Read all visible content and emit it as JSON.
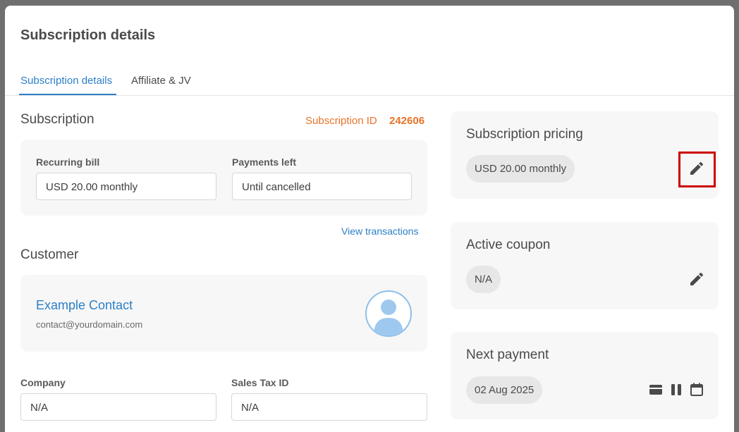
{
  "modal": {
    "title": "Subscription details"
  },
  "tabs": [
    {
      "label": "Subscription details",
      "active": true
    },
    {
      "label": "Affiliate & JV",
      "active": false
    }
  ],
  "subscription": {
    "heading": "Subscription",
    "id_label": "Subscription ID",
    "id_value": "242606",
    "recurring_label": "Recurring bill",
    "recurring_value": "USD 20.00 monthly",
    "payments_left_label": "Payments left",
    "payments_left_value": "Until cancelled",
    "view_transactions": "View transactions"
  },
  "customer": {
    "heading": "Customer",
    "name": "Example Contact",
    "email": "contact@yourdomain.com",
    "company_label": "Company",
    "company_value": "N/A",
    "tax_label": "Sales Tax ID",
    "tax_value": "N/A"
  },
  "pricing": {
    "heading": "Subscription pricing",
    "value": "USD 20.00 monthly"
  },
  "coupon": {
    "heading": "Active coupon",
    "value": "N/A"
  },
  "next_payment": {
    "heading": "Next payment",
    "value": "02 Aug 2025"
  },
  "colors": {
    "accent": "#2b7fc8",
    "subscription_id": "#e8742a",
    "highlight": "#cc0000"
  },
  "icons": [
    "pencil-icon",
    "credit-card-icon",
    "pause-icon",
    "calendar-icon",
    "user-avatar-icon"
  ]
}
